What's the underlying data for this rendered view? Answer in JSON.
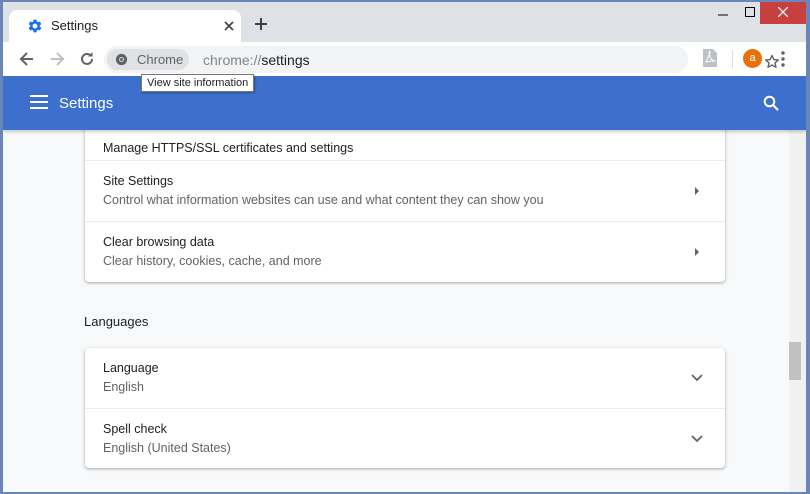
{
  "tab": {
    "title": "Settings"
  },
  "toolbar": {
    "chip_label": "Chrome",
    "url_scheme": "chrome://",
    "url_host": "settings",
    "avatar_letter": "a"
  },
  "tooltip": "View site information",
  "header": {
    "title": "Settings"
  },
  "privacy_card": {
    "rows": [
      {
        "secondary": "Manage HTTPS/SSL certificates and settings"
      },
      {
        "primary": "Site Settings",
        "secondary": "Control what information websites can use and what content they can show you"
      },
      {
        "primary": "Clear browsing data",
        "secondary": "Clear history, cookies, cache, and more"
      }
    ]
  },
  "languages": {
    "section_title": "Languages",
    "rows": [
      {
        "primary": "Language",
        "secondary": "English"
      },
      {
        "primary": "Spell check",
        "secondary": "English (United States)"
      }
    ]
  },
  "colors": {
    "accent": "#3c6fce",
    "avatar": "#e8710a",
    "close": "#c83f3f"
  }
}
